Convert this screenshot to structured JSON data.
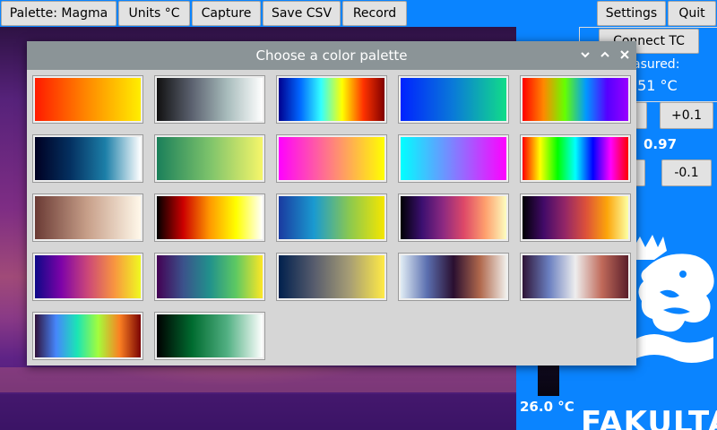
{
  "toolbar": {
    "palette_label": "Palette: Magma",
    "units_label": "Units °C",
    "capture_label": "Capture",
    "save_csv_label": "Save CSV",
    "record_label": "Record",
    "settings_label": "Settings",
    "quit_label": "Quit"
  },
  "panel": {
    "connect_label": "Connect TC",
    "measured_label": "asured:",
    "measured_value": ".51 °C",
    "plus_label": "+0.1",
    "emissivity_value": "0.97",
    "minus_label": "-0.1"
  },
  "temperature": {
    "bar_label": "26.0 °C"
  },
  "logo": {
    "text": "FAKULTA"
  },
  "dialog": {
    "title": "Choose a color palette",
    "icons": [
      "chevron-down-icon",
      "chevron-up-icon",
      "close-icon"
    ],
    "palettes": [
      {
        "stops": [
          "#ff1a00",
          "#ff8a00",
          "#ffee00"
        ]
      },
      {
        "stops": [
          "#111111",
          "#5c6270",
          "#a8bcbc",
          "#ffffff"
        ]
      },
      {
        "stops": [
          "#00008f",
          "#0066ff",
          "#33ffff",
          "#ffff00",
          "#ff3300",
          "#800000"
        ]
      },
      {
        "stops": [
          "#0022ff",
          "#0a7ad8",
          "#11dd88"
        ]
      },
      {
        "stops": [
          "#ff0000",
          "#ff8800",
          "#66ff00",
          "#0099ff",
          "#5500ff",
          "#9900ff"
        ]
      },
      {
        "stops": [
          "#000022",
          "#043060",
          "#1c7fa8",
          "#ffffff"
        ]
      },
      {
        "stops": [
          "#1a7f5a",
          "#7dc36b",
          "#f6f66a"
        ]
      },
      {
        "stops": [
          "#ff00ff",
          "#ff8080",
          "#ffff00"
        ]
      },
      {
        "stops": [
          "#00ffff",
          "#8080ff",
          "#ff00ff"
        ]
      },
      {
        "stops": [
          "#ff0000",
          "#ffff00",
          "#00ff00",
          "#00ffff",
          "#0000ff",
          "#ff00ff",
          "#ff0000"
        ]
      },
      {
        "stops": [
          "#6a3a34",
          "#c8a08a",
          "#fff8ea"
        ]
      },
      {
        "stops": [
          "#000000",
          "#cc0000",
          "#ff9900",
          "#ffff00",
          "#ffffff"
        ]
      },
      {
        "stops": [
          "#1a3aa0",
          "#1a9ad0",
          "#8ac850",
          "#f5e600"
        ]
      },
      {
        "stops": [
          "#000004",
          "#3b0f70",
          "#8c2981",
          "#de4968",
          "#fe9f6d",
          "#fcfdbf"
        ]
      },
      {
        "stops": [
          "#000004",
          "#420a68",
          "#932667",
          "#dd513a",
          "#fca50a",
          "#fcffa4"
        ]
      },
      {
        "stops": [
          "#0d0887",
          "#7e03a8",
          "#cc4778",
          "#f89540",
          "#f0f921"
        ]
      },
      {
        "stops": [
          "#440154",
          "#3b528b",
          "#21918c",
          "#5ec962",
          "#fde725"
        ]
      },
      {
        "stops": [
          "#00204d",
          "#575c6d",
          "#a69d75",
          "#ffea46"
        ]
      },
      {
        "stops": [
          "#e0ecf4",
          "#5b6fb0",
          "#2a0f30",
          "#b0684c",
          "#f0eeea"
        ]
      },
      {
        "stops": [
          "#2f1436",
          "#6a7fc0",
          "#eeeeee",
          "#c06a5a",
          "#5a1e2a"
        ]
      },
      {
        "stops": [
          "#30123b",
          "#4686fb",
          "#1be5b5",
          "#a4fc3c",
          "#fb8022",
          "#7a0403"
        ]
      },
      {
        "stops": [
          "#000000",
          "#006b2f",
          "#52b083",
          "#ffffff"
        ]
      }
    ]
  }
}
